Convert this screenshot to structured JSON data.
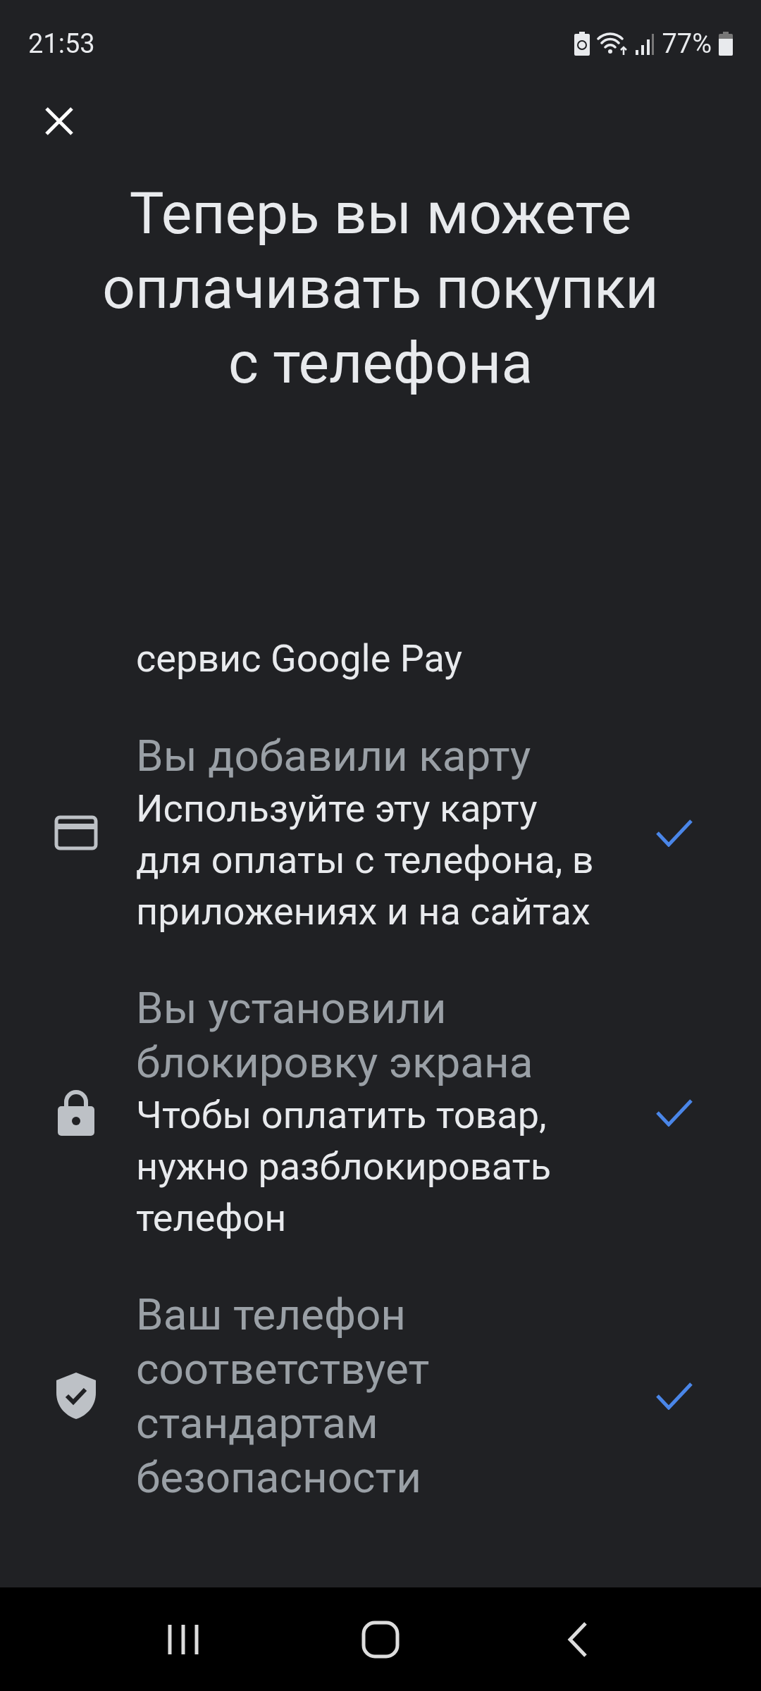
{
  "status_bar": {
    "time": "21:53",
    "battery": "77%"
  },
  "title": "Теперь вы можете\nоплачивать покупки\nс телефона",
  "partial_text": "сервис Google Pay",
  "steps": [
    {
      "kind": "card",
      "title": "Вы добавили карту",
      "description": "Используйте эту карту\nдля оплаты с телефона, в\nприложениях и на сайтах",
      "checked": true
    },
    {
      "kind": "lock",
      "title": "Вы установили\nблокировку экрана",
      "description": "Чтобы оплатить товар,\nнужно разблокировать\nтелефон",
      "checked": true
    },
    {
      "kind": "shield",
      "title": "Ваш телефон\nсоответствует\nстандартам\nбезопасности",
      "checked": true
    }
  ]
}
